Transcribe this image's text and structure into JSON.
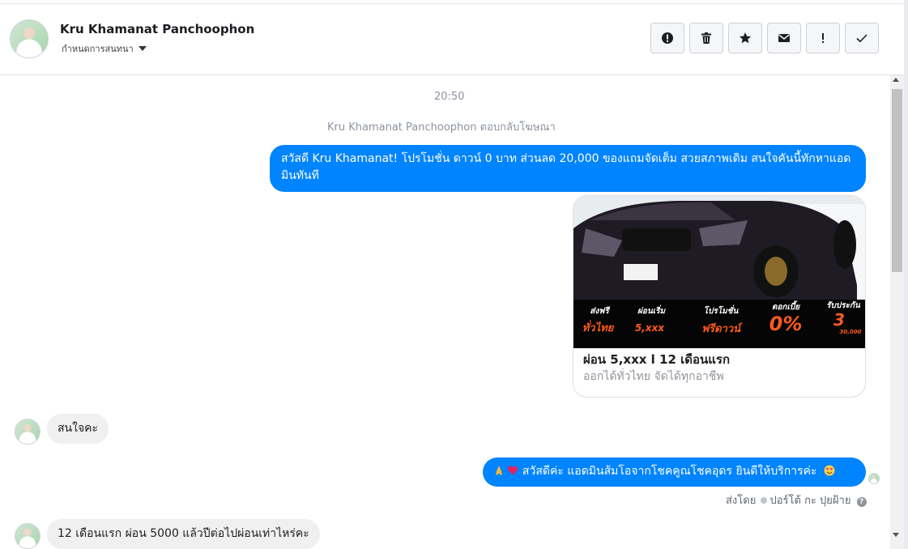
{
  "header": {
    "name": "Kru Khamanat Panchoophon",
    "subtitle": "กำหนดการสนทนา",
    "toolbar": [
      {
        "icon": "alert-circle-icon",
        "label": "Mark as spam"
      },
      {
        "icon": "trash-icon",
        "label": "Delete"
      },
      {
        "icon": "star-icon",
        "label": "Star"
      },
      {
        "icon": "envelope-icon",
        "label": "Mark as unread"
      },
      {
        "icon": "exclamation-icon",
        "label": "Follow up"
      },
      {
        "icon": "check-icon",
        "label": "Mark as done"
      }
    ]
  },
  "conversation": {
    "timestamp": "20:50",
    "system_note": "Kru Khamanat Panchoophon ตอบกลับโฆษณา",
    "messages": [
      {
        "from": "page",
        "text": "สวัสดี Kru Khamanat! โปรโมชั่น ดาวน์ 0 บาท ส่วนลด 20,000 ของแถมจัดเต็ม สวยสภาพเดิม สนใจคันนี้ทักหาแอดมินทันที"
      },
      {
        "from": "user",
        "text": "สนใจคะ"
      },
      {
        "from": "page",
        "text": "สวัสดีค่ะ แอดมินส้มโอจากโชคคูณโชคอุดร ยินดีให้บริการค่ะ"
      },
      {
        "from": "user",
        "text": "12 เดือนแรก ผ่อน 5000 แล้วปีต่อไปผ่อนเท่าไหร่คะ"
      }
    ],
    "ad_card": {
      "title": "ผ่อน 5,xxx l 12 เดือนแรก",
      "subtitle": "ออกได้ทั่วไทย จัดได้ทุกอาชีพ",
      "banner": [
        {
          "top": "ส่งฟรี",
          "bottom": "ทั่วไทย"
        },
        {
          "top": "ผ่อนเริ่ม",
          "bottom": "5,xxx"
        },
        {
          "top": "โปรโมชั่น",
          "bottom": "ฟรีดาวน์"
        },
        {
          "top": "ดอกเบี้ย",
          "bottom": "0%"
        },
        {
          "top": "รับประกัน",
          "bottom": "3",
          "extra": "30,000"
        }
      ]
    },
    "sent_by": {
      "prefix": "ส่งโดย",
      "name": "ปอร์โต้ กะ ปุยฝ้าย"
    }
  },
  "colors": {
    "accent": "#0084ff",
    "incoming": "#f1f0f0",
    "banner_orange": "#ff5a1f"
  }
}
